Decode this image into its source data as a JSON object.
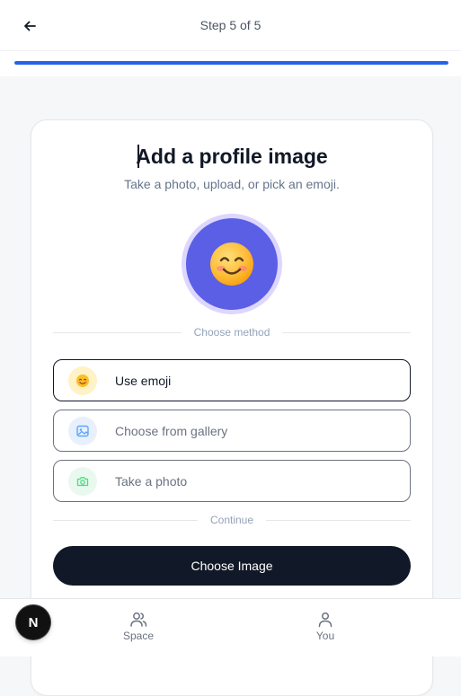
{
  "header": {
    "step_text": "Step 5 of 5",
    "back_icon": "arrow-left-icon",
    "progress": 1.0,
    "progress_color": "#2563eb"
  },
  "card": {
    "title": "Add a profile image",
    "subtitle": "Take a photo, upload, or pick an emoji.",
    "avatar_emoji": "😊",
    "avatar_bg": "#5b5fe6",
    "method_divider": "Choose method",
    "options": [
      {
        "label": "Use emoji",
        "icon": "smiley-icon",
        "selected": true
      },
      {
        "label": "Choose from gallery",
        "icon": "image-icon",
        "selected": false
      },
      {
        "label": "Take a photo",
        "icon": "camera-icon",
        "selected": false
      }
    ],
    "continue_divider": "Continue",
    "primary_button": "Choose Image"
  },
  "bottom_nav": {
    "items": [
      {
        "label": "Space",
        "icon": "users-icon"
      },
      {
        "label": "You",
        "icon": "user-icon"
      }
    ],
    "badge_letter": "N"
  }
}
